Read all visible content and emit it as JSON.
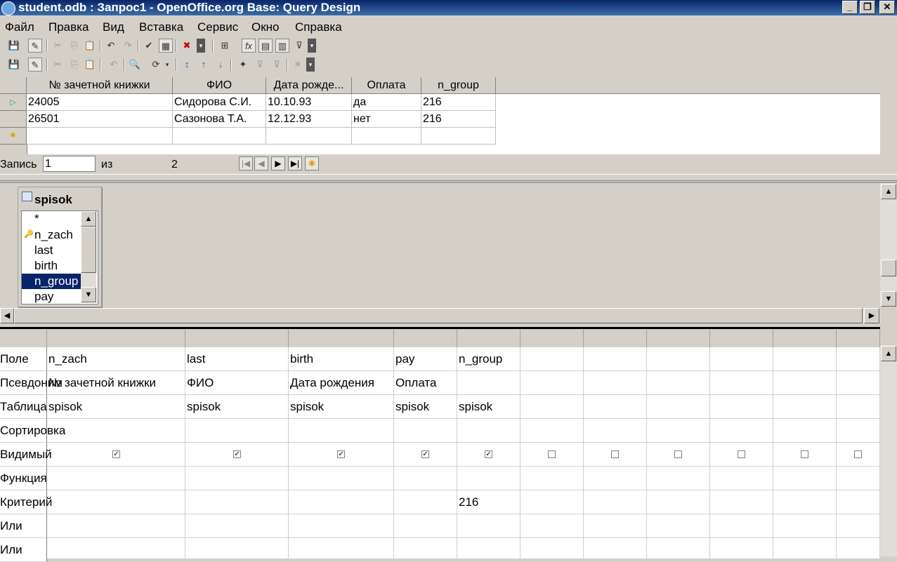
{
  "window": {
    "title": "student.odb : Запрос1 - OpenOffice.org Base: Query Design"
  },
  "menu": [
    "Файл",
    "Правка",
    "Вид",
    "Вставка",
    "Сервис",
    "Окно",
    "Справка"
  ],
  "result_grid": {
    "headers": [
      "№ зачетной книжки",
      "ФИО",
      "Дата рожде...",
      "Оплата",
      "n_group"
    ],
    "rows": [
      [
        "24005",
        "Сидорова С.И.",
        "10.10.93",
        "да",
        "216"
      ],
      [
        "26501",
        "Сазонова Т.А.",
        "12.12.93",
        "нет",
        "216"
      ]
    ]
  },
  "record_nav": {
    "label": "Запись",
    "current": "1",
    "of_label": "из",
    "total": "2"
  },
  "table_window": {
    "title": "spisok",
    "fields": [
      "*",
      "n_zach",
      "last",
      "birth",
      "n_group",
      "pay"
    ],
    "selected_field": "n_group"
  },
  "criteria": {
    "row_labels": [
      "Поле",
      "Псевдоним",
      "Таблица",
      "Сортировка",
      "Видимый",
      "Функция",
      "Критерий",
      "Или",
      "Или"
    ],
    "columns": [
      {
        "field": "n_zach",
        "alias": "№ зачетной книжки",
        "table": "spisok",
        "visible": true,
        "criterion": ""
      },
      {
        "field": "last",
        "alias": "ФИО",
        "table": "spisok",
        "visible": true,
        "criterion": ""
      },
      {
        "field": "birth",
        "alias": "Дата рождения",
        "table": "spisok",
        "visible": true,
        "criterion": ""
      },
      {
        "field": "pay",
        "alias": "Оплата",
        "table": "spisok",
        "visible": true,
        "criterion": ""
      },
      {
        "field": "n_group",
        "alias": "",
        "table": "spisok",
        "visible": true,
        "criterion": "216"
      },
      {
        "field": "",
        "alias": "",
        "table": "",
        "visible": false,
        "criterion": ""
      },
      {
        "field": "",
        "alias": "",
        "table": "",
        "visible": false,
        "criterion": ""
      },
      {
        "field": "",
        "alias": "",
        "table": "",
        "visible": false,
        "criterion": ""
      },
      {
        "field": "",
        "alias": "",
        "table": "",
        "visible": false,
        "criterion": ""
      },
      {
        "field": "",
        "alias": "",
        "table": "",
        "visible": false,
        "criterion": ""
      },
      {
        "field": "",
        "alias": "",
        "table": "",
        "visible": false,
        "criterion": ""
      }
    ]
  }
}
